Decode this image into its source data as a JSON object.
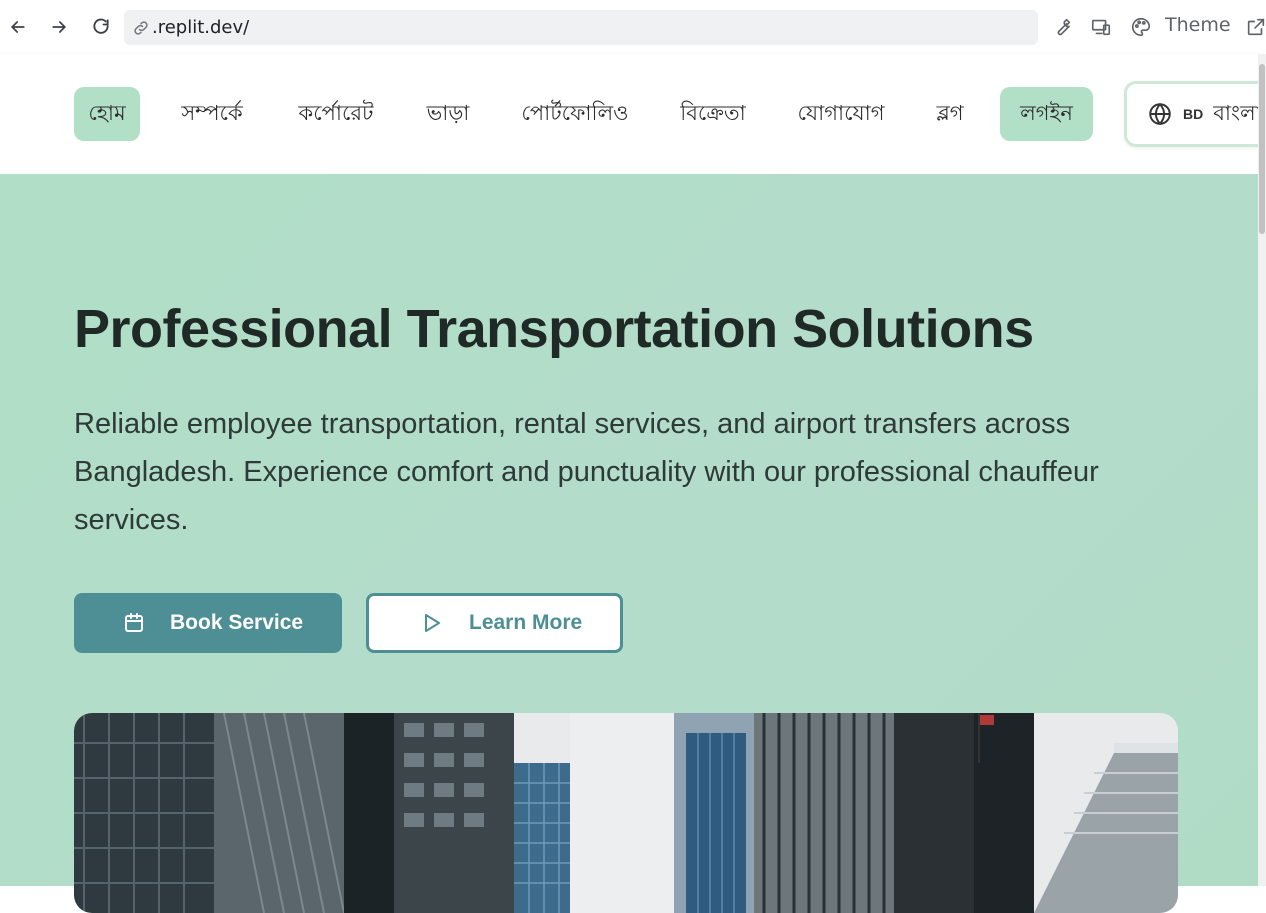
{
  "browser": {
    "url": ".replit.dev/",
    "theme_label": "Theme"
  },
  "nav": {
    "items": [
      {
        "label": "হোম",
        "active": true
      },
      {
        "label": "সম্পর্কে",
        "active": false
      },
      {
        "label": "কর্পোরেট",
        "active": false
      },
      {
        "label": "ভাড়া",
        "active": false
      },
      {
        "label": "পোর্টফোলিও",
        "active": false
      },
      {
        "label": "বিক্রেতা",
        "active": false
      },
      {
        "label": "যোগাযোগ",
        "active": false
      },
      {
        "label": "ব্লগ",
        "active": false
      }
    ],
    "login_label": "লগইন",
    "language": {
      "code": "BD",
      "label": "বাংলা"
    }
  },
  "hero": {
    "title": "Professional Transportation Solutions",
    "description": "Reliable employee transportation, rental services, and airport transfers across Bangladesh. Experience comfort and punctuality with our professional chauffeur services.",
    "primary_button": "Book Service",
    "secondary_button": "Learn More"
  },
  "colors": {
    "hero_bg": "#b0dec6",
    "accent": "#4d8f94",
    "nav_active": "#b1e0c6"
  }
}
